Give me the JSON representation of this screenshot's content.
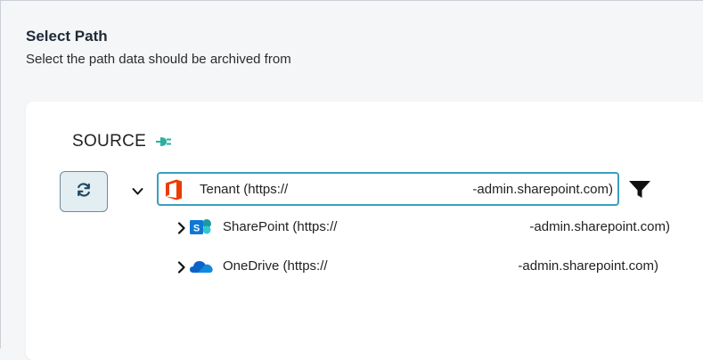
{
  "header": {
    "title": "Select Path",
    "subtitle": "Select the path data should be archived from"
  },
  "source": {
    "label": "SOURCE",
    "icon": "plug-icon",
    "icon_color": "#2bb0a0"
  },
  "refresh_button": {
    "icon": "refresh-icon"
  },
  "tree": {
    "tenant": {
      "label_prefix": "Tenant (https://",
      "label_suffix": "-admin.sharepoint.com)",
      "expanded": true,
      "selected": true,
      "icon": "office-icon",
      "filter_icon": "filter-icon"
    },
    "children": [
      {
        "label_prefix": "SharePoint (https://",
        "label_suffix": "-admin.sharepoint.com)",
        "icon": "sharepoint-icon",
        "expanded": false
      },
      {
        "label_prefix": "OneDrive (https://",
        "label_suffix": "-admin.sharepoint.com)",
        "icon": "onedrive-icon",
        "expanded": false
      }
    ]
  },
  "colors": {
    "accent": "#3a9fbf",
    "office": "#eb3c00",
    "sharepoint": "#0f78d4",
    "onedrive": "#0a64c8"
  }
}
